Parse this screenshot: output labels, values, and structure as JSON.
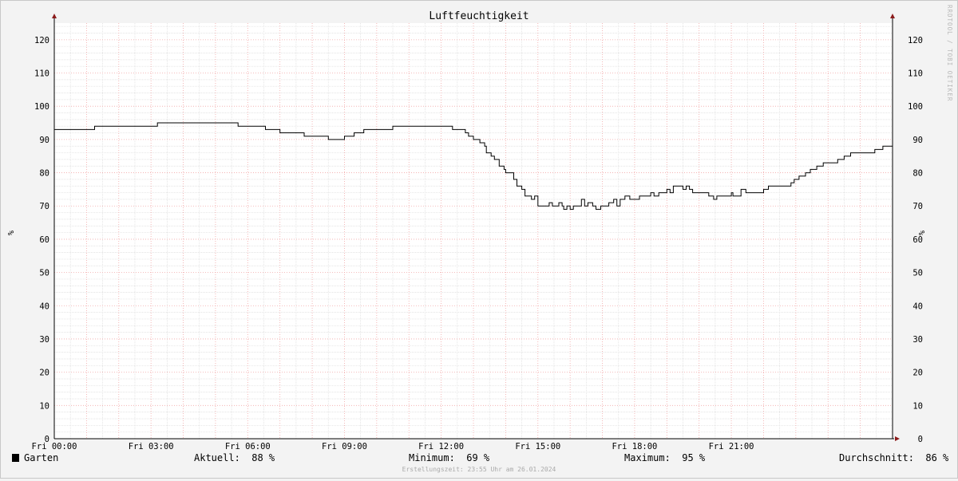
{
  "chart_data": {
    "type": "line",
    "title": "Luftfeuchtigkeit",
    "ylabel_left": "%",
    "ylabel_right": "%",
    "ylim": [
      0,
      125
    ],
    "yticks": [
      0,
      10,
      20,
      30,
      40,
      50,
      60,
      70,
      80,
      90,
      100,
      110,
      120
    ],
    "xlim_hours": [
      0,
      24
    ],
    "xticks": [
      {
        "hour": 0,
        "label": "Fri 00:00"
      },
      {
        "hour": 3,
        "label": "Fri 03:00"
      },
      {
        "hour": 6,
        "label": "Fri 06:00"
      },
      {
        "hour": 9,
        "label": "Fri 09:00"
      },
      {
        "hour": 12,
        "label": "Fri 12:00"
      },
      {
        "hour": 15,
        "label": "Fri 15:00"
      },
      {
        "hour": 18,
        "label": "Fri 18:00"
      },
      {
        "hour": 21,
        "label": "Fri 21:00"
      }
    ],
    "grid": true,
    "series": [
      {
        "name": "Garten",
        "color": "#000000",
        "points": [
          [
            0.0,
            93
          ],
          [
            1.25,
            94
          ],
          [
            3.2,
            95
          ],
          [
            5.7,
            94
          ],
          [
            6.55,
            93
          ],
          [
            7.0,
            92
          ],
          [
            7.75,
            91
          ],
          [
            8.5,
            90
          ],
          [
            9.0,
            91
          ],
          [
            9.3,
            92
          ],
          [
            9.6,
            93
          ],
          [
            10.5,
            94
          ],
          [
            12.35,
            93
          ],
          [
            12.75,
            92
          ],
          [
            12.85,
            91
          ],
          [
            13.0,
            90
          ],
          [
            13.2,
            89
          ],
          [
            13.35,
            88
          ],
          [
            13.4,
            86
          ],
          [
            13.55,
            85
          ],
          [
            13.65,
            84
          ],
          [
            13.8,
            82
          ],
          [
            13.95,
            81
          ],
          [
            14.0,
            80
          ],
          [
            14.25,
            78
          ],
          [
            14.35,
            76
          ],
          [
            14.5,
            75
          ],
          [
            14.6,
            73
          ],
          [
            14.8,
            72
          ],
          [
            14.9,
            73
          ],
          [
            15.0,
            70
          ],
          [
            15.2,
            70
          ],
          [
            15.35,
            71
          ],
          [
            15.45,
            70
          ],
          [
            15.65,
            71
          ],
          [
            15.75,
            70
          ],
          [
            15.8,
            69
          ],
          [
            15.9,
            70
          ],
          [
            16.0,
            69
          ],
          [
            16.1,
            70
          ],
          [
            16.25,
            70
          ],
          [
            16.35,
            72
          ],
          [
            16.45,
            70
          ],
          [
            16.55,
            71
          ],
          [
            16.7,
            70
          ],
          [
            16.8,
            69
          ],
          [
            16.95,
            70
          ],
          [
            17.2,
            71
          ],
          [
            17.35,
            72
          ],
          [
            17.45,
            70
          ],
          [
            17.55,
            72
          ],
          [
            17.7,
            73
          ],
          [
            17.85,
            72
          ],
          [
            18.15,
            73
          ],
          [
            18.5,
            74
          ],
          [
            18.6,
            73
          ],
          [
            18.75,
            74
          ],
          [
            19.0,
            75
          ],
          [
            19.1,
            74
          ],
          [
            19.2,
            76
          ],
          [
            19.35,
            76
          ],
          [
            19.5,
            75
          ],
          [
            19.6,
            76
          ],
          [
            19.7,
            75
          ],
          [
            19.8,
            74
          ],
          [
            20.3,
            73
          ],
          [
            20.45,
            72
          ],
          [
            20.55,
            73
          ],
          [
            21.0,
            74
          ],
          [
            21.05,
            73
          ],
          [
            21.3,
            75
          ],
          [
            21.45,
            74
          ],
          [
            22.0,
            75
          ],
          [
            22.15,
            76
          ],
          [
            22.85,
            77
          ],
          [
            22.95,
            78
          ],
          [
            23.1,
            79
          ],
          [
            23.3,
            80
          ],
          [
            23.45,
            81
          ],
          [
            23.65,
            82
          ],
          [
            23.85,
            83
          ],
          [
            24.0,
            83
          ],
          [
            24.3,
            84
          ],
          [
            24.5,
            85
          ],
          [
            24.7,
            86
          ],
          [
            25.45,
            87
          ],
          [
            25.7,
            88
          ],
          [
            26.0,
            88
          ]
        ]
      }
    ]
  },
  "watermark": "RRDTOOL / TOBI OETIKER",
  "legend": {
    "series_name": "Garten",
    "aktuell_label": "Aktuell:",
    "aktuell_value": "88 %",
    "minimum_label": "Minimum:",
    "minimum_value": "69 %",
    "maximum_label": "Maximum:",
    "maximum_value": "95 %",
    "durchschnitt_label": "Durchschnitt:",
    "durchschnitt_value": "86 %"
  },
  "footer": "Erstellungszeit: 23:55 Uhr am 26.01.2024",
  "colors": {
    "background": "#f3f3f3",
    "plot_background": "#ffffff",
    "minor_grid": "#dcdcdc",
    "major_grid": "#f2a7a7",
    "axis_arrow": "#8b1a1a",
    "line": "#000000"
  }
}
